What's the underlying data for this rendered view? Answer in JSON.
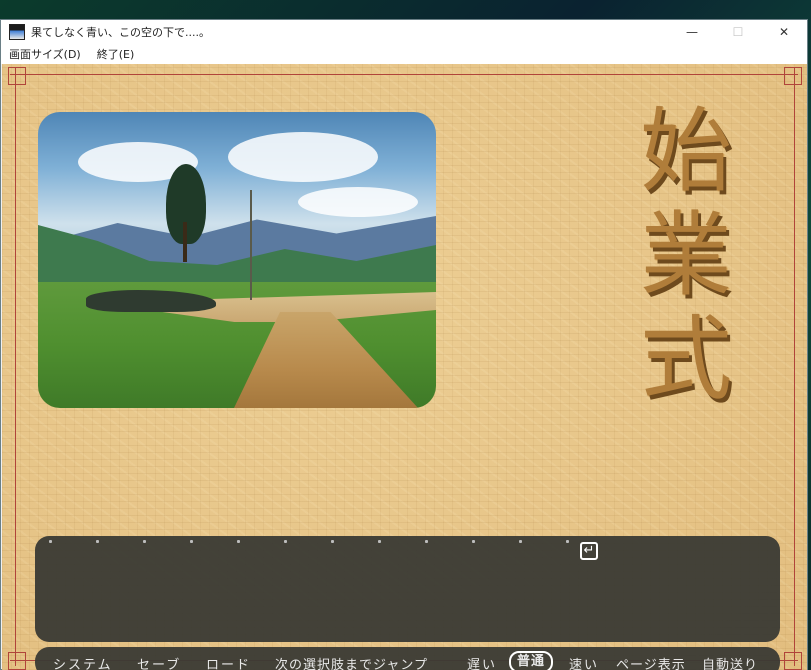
{
  "window": {
    "title": "果てしなく青い、この空の下で....。",
    "controls": {
      "minimize": "—",
      "maximize": "☐",
      "close": "✕"
    }
  },
  "menu": {
    "items": [
      {
        "label": "画面サイズ(D)"
      },
      {
        "label": "終了(E)"
      }
    ]
  },
  "scene": {
    "chapter_title_chars": [
      "始",
      "業",
      "式"
    ]
  },
  "message_window": {
    "enter_icon": "↵"
  },
  "control_bar": {
    "system": "システム",
    "save": "セーブ",
    "load": "ロード",
    "skip_to_choice": "次の選択肢までジャンプ",
    "speed_slow": "遅い",
    "speed_normal": "普通",
    "speed_fast": "速い",
    "page_display": "ページ表示",
    "auto_advance": "自動送り",
    "selected_speed": "普通"
  },
  "colors": {
    "frame": "#b0443a",
    "panel": "#3a3a34",
    "title_gold": "#b07d3a",
    "paper": "#e6c487"
  }
}
